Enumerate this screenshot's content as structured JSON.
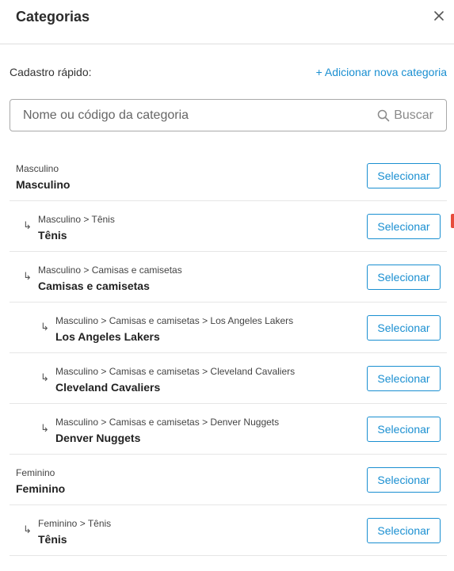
{
  "header": {
    "title": "Categorias",
    "close_icon": "close-icon"
  },
  "quick_add": {
    "label": "Cadastro rápido:",
    "add_link": "+ Adicionar nova categoria"
  },
  "search": {
    "placeholder": "Nome ou código da categoria",
    "button_label": "Buscar",
    "icon": "search-icon"
  },
  "categories": [
    {
      "level": 0,
      "path": "Masculino",
      "name": "Masculino",
      "button": "Selecionar"
    },
    {
      "level": 1,
      "path": "Masculino > Tênis",
      "name": "Tênis",
      "button": "Selecionar"
    },
    {
      "level": 1,
      "path": "Masculino > Camisas e camisetas",
      "name": "Camisas e camisetas",
      "button": "Selecionar"
    },
    {
      "level": 2,
      "path": "Masculino > Camisas e camisetas > Los Angeles Lakers",
      "name": "Los Angeles Lakers",
      "button": "Selecionar"
    },
    {
      "level": 2,
      "path": "Masculino > Camisas e camisetas > Cleveland Cavaliers",
      "name": "Cleveland Cavaliers",
      "button": "Selecionar"
    },
    {
      "level": 2,
      "path": "Masculino > Camisas e camisetas > Denver Nuggets",
      "name": "Denver Nuggets",
      "button": "Selecionar"
    },
    {
      "level": 0,
      "path": "Feminino",
      "name": "Feminino",
      "button": "Selecionar"
    },
    {
      "level": 1,
      "path": "Feminino > Tênis",
      "name": "Tênis",
      "button": "Selecionar"
    }
  ],
  "subcategory_arrow": "↳",
  "colors": {
    "accent": "#1a8fd1",
    "border": "#a9a9a9",
    "divider": "#e6e6e6"
  }
}
